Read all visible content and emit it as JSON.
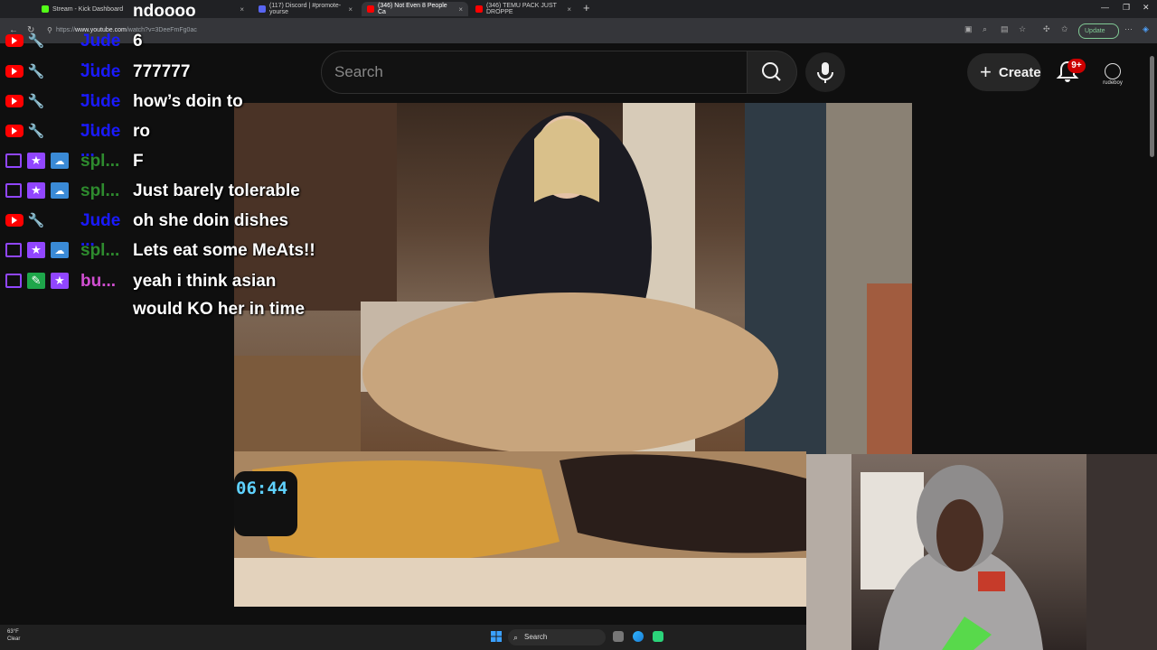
{
  "browser": {
    "tabs": [
      {
        "title": "Stream - Kick Dashboard",
        "fav": "#53fc18",
        "active": false
      },
      {
        "title": "",
        "fav": "#777777",
        "active": false
      },
      {
        "title": "(117) Discord | #promote-yourse",
        "fav": "#5865f2",
        "active": false
      },
      {
        "title": "(346) Not Even 8 People Ca",
        "fav": "#ff0000",
        "active": true
      },
      {
        "title": "(346) TEMU PACK JUST DROPPE",
        "fav": "#ff0000",
        "active": false
      }
    ],
    "url_host": "www.youtube.com",
    "url_path": "/watch?v=3DeeFmFg0ac",
    "url_prefix": "https://",
    "update_label": "Update"
  },
  "youtube": {
    "search_placeholder": "Search",
    "create_label": "Create",
    "notif_badge": "9+",
    "avatar_text": "rudeboy"
  },
  "chat": {
    "top_message": "ndoooo",
    "messages": [
      {
        "platform": "youtube",
        "user": "Jude ...",
        "text": "6",
        "color": "#1a1aff"
      },
      {
        "platform": "youtube",
        "user": "Jude ...",
        "text": "777777",
        "color": "#1a1aff"
      },
      {
        "platform": "youtube",
        "user": "Jude ...",
        "text": "how’s doin to",
        "color": "#1a1aff"
      },
      {
        "platform": "youtube",
        "user": "Jude ...",
        "text": "ro",
        "color": "#1a1aff"
      },
      {
        "platform": "twitch",
        "user": "spl...",
        "text": "F",
        "color": "#2e8b2e"
      },
      {
        "platform": "twitch",
        "user": "spl...",
        "text": "Just barely tolerable",
        "color": "#2e8b2e"
      },
      {
        "platform": "youtube",
        "user": "Jude ...",
        "text": "oh she doin dishes",
        "color": "#1a1aff"
      },
      {
        "platform": "twitch",
        "user": "spl...",
        "text": "Lets eat some MeAts!!",
        "color": "#2e8b2e"
      },
      {
        "platform": "twitch",
        "user": "bu...",
        "text": "yeah i think asian",
        "color": "#d14fd1"
      }
    ],
    "continuation": "would KO her in time"
  },
  "video": {
    "timer_text": "06:44"
  },
  "taskbar": {
    "weather_temp": "63°F",
    "weather_desc": "Clear",
    "search_label": "Search"
  },
  "colors": {
    "youtube_red": "#ff0000",
    "twitch_purple": "#9146ff"
  }
}
